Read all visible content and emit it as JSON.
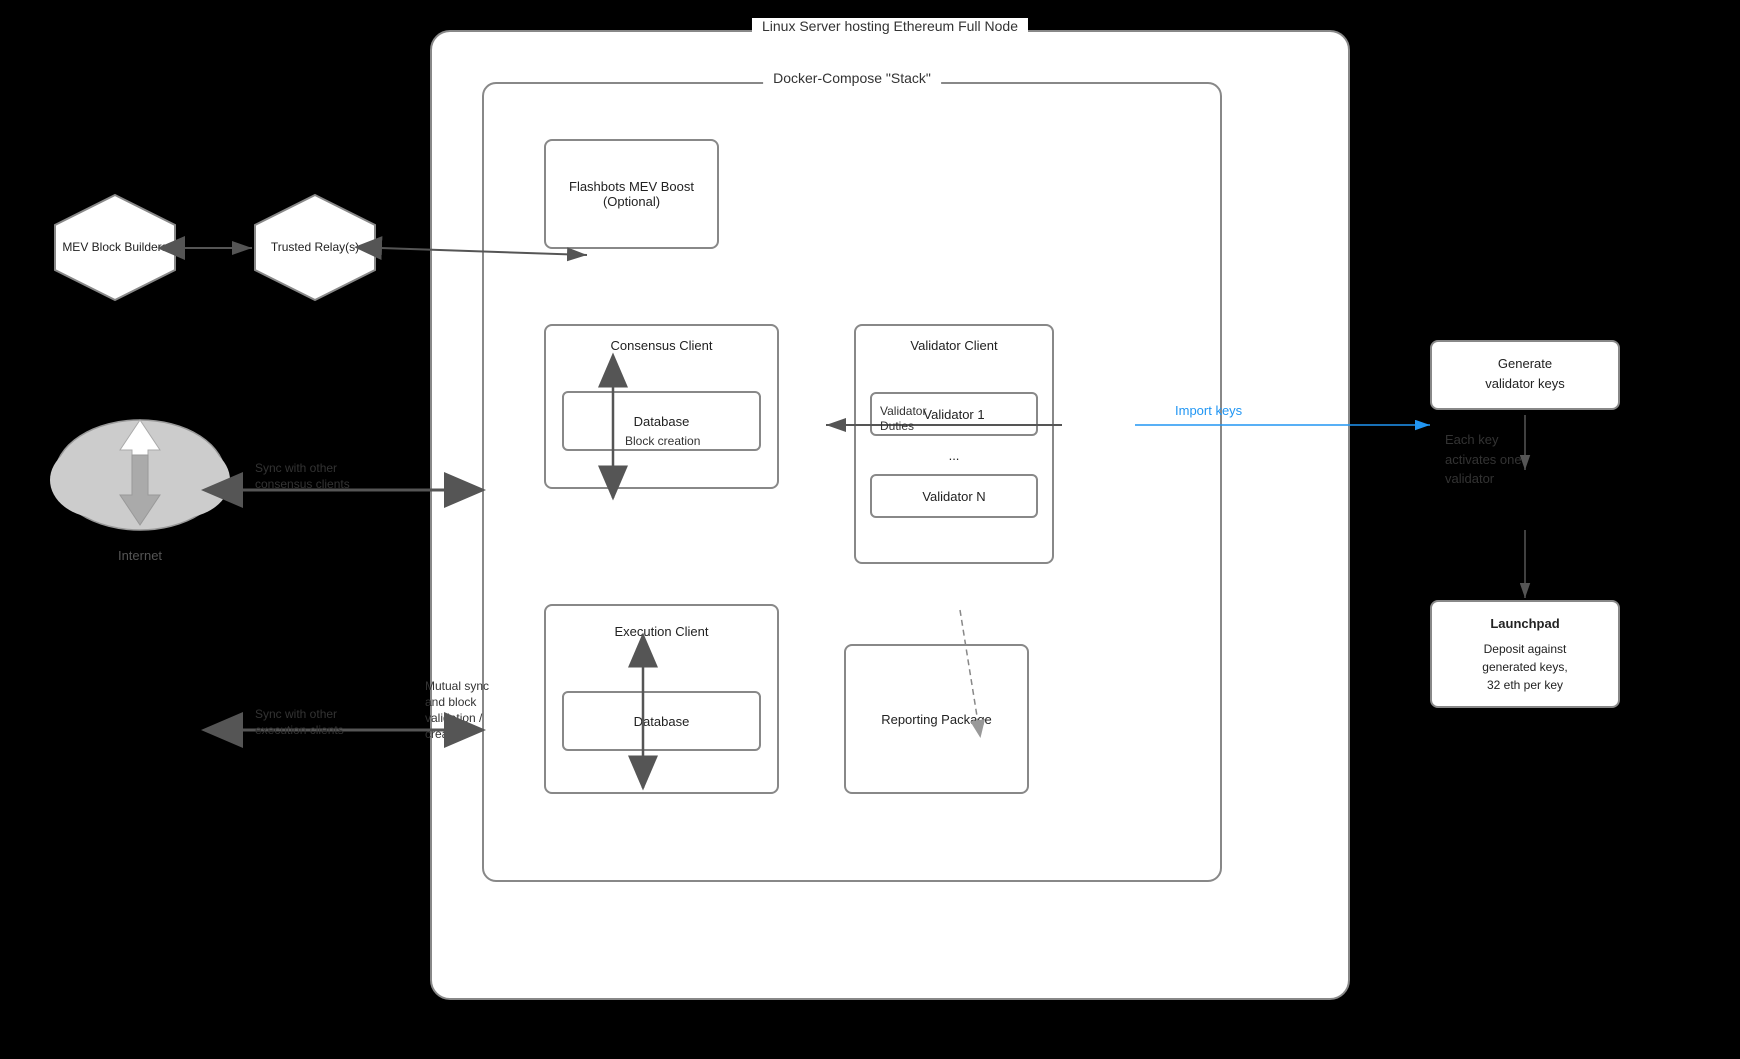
{
  "diagram": {
    "background": "#000000",
    "linux_server": {
      "label": "Linux Server hosting Ethereum Full Node"
    },
    "docker": {
      "label": "Docker-Compose \"Stack\""
    },
    "flashbots": {
      "label": "Flashbots MEV Boost (Optional)"
    },
    "consensus": {
      "title": "Consensus Client",
      "db_label": "Database"
    },
    "execution": {
      "title": "Execution Client",
      "db_label": "Database"
    },
    "validator": {
      "title": "Validator Client",
      "validator1": "Validator 1",
      "dots": "...",
      "validatorN": "Validator N"
    },
    "reporting": {
      "label": "Reporting Package"
    },
    "mev_builders": {
      "label": "MEV Block Builders"
    },
    "trusted_relay": {
      "label": "Trusted Relay(s)"
    },
    "internet": {
      "label": "Internet"
    },
    "arrows": {
      "block_creation": "Block creation",
      "sync_consensus": "Sync with other\nconsensus clients",
      "sync_execution": "Sync with other\nexecution clients",
      "validator_duties": "Validator\nDuties",
      "mutual_sync": "Mutual sync\nand block\nvalidation /\ncreation",
      "import_keys": "Import keys"
    },
    "right_panel": {
      "generate_keys": "Generate\nvalidator keys",
      "each_key": "Each key\nactivates one\nvalidator",
      "launchpad": "Launchpad",
      "deposit": "Deposit against\ngenerated keys,\n32 eth per key"
    }
  }
}
